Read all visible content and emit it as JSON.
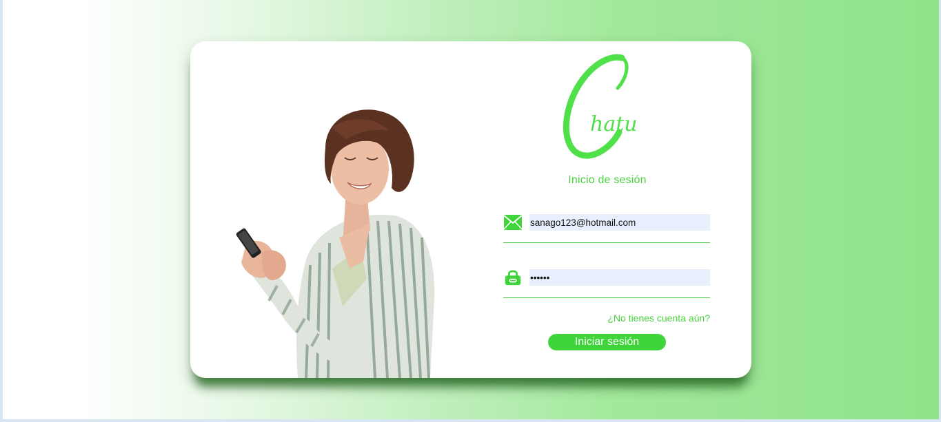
{
  "brand": {
    "name": "Chatu",
    "color": "#4fe04a"
  },
  "login": {
    "title": "Inicio de sesión",
    "email": {
      "value": "sanago123@hotmail.com",
      "icon": "envelope-icon"
    },
    "password": {
      "value": "••••••",
      "icon": "lock-icon"
    },
    "signup_link": "¿No tienes cuenta aún?",
    "submit_label": "Iniciar sesión"
  },
  "colors": {
    "accent": "#49d23f",
    "button": "#3fd53a",
    "input_bg": "#e8f0fe",
    "card_shadow": "#2c6e28"
  },
  "illustration": {
    "icon": "woman-with-phone-photo"
  }
}
